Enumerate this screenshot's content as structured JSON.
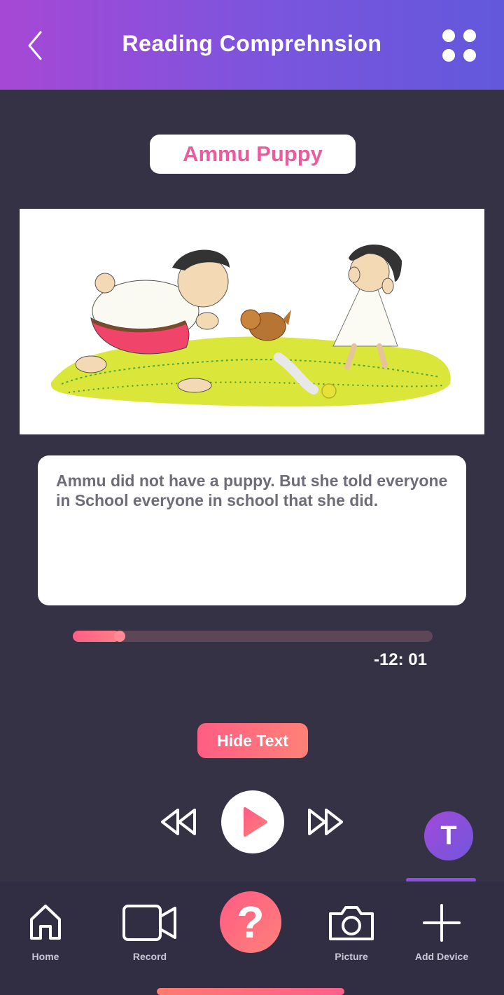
{
  "header": {
    "title": "Reading Comprehnsion",
    "back_icon": "chevron-left-icon",
    "menu_icon": "four-dots-grid-icon"
  },
  "story": {
    "title": "Ammu Puppy",
    "illustration": "boy-girl-puppy-tennis-ball-on-grass",
    "text": "Ammu did not have a puppy. But she told everyone in School everyone in school that she did."
  },
  "player": {
    "progress": 0.13,
    "time_remaining": "-12: 01",
    "hide_text_label": "Hide Text",
    "rewind_icon": "rewind-icon",
    "play_icon": "play-icon",
    "forward_icon": "fast-forward-icon"
  },
  "avatar": {
    "initial": "T"
  },
  "nav": {
    "items": [
      {
        "label": "Home",
        "icon": "home-icon"
      },
      {
        "label": "Record",
        "icon": "video-camera-icon"
      },
      {
        "label": "?",
        "icon": "help-icon"
      },
      {
        "label": "Picture",
        "icon": "camera-icon"
      },
      {
        "label": "Add Device",
        "icon": "plus-icon"
      }
    ]
  },
  "colors": {
    "header_gradient_start": "#a648d6",
    "header_gradient_end": "#6258dc",
    "background": "#353246",
    "accent_pink": "#ff5d83",
    "title_pink": "#ea5c9d"
  }
}
